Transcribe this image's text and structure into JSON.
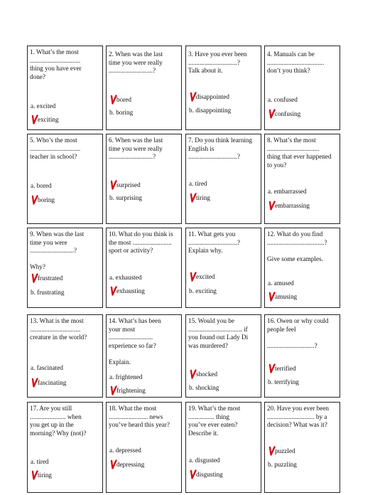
{
  "colors": {
    "tick": "#d0141b",
    "border": "#222222",
    "text": "#111111"
  },
  "cards": [
    {
      "id": 1,
      "lines": [
        "1. What’s the most",
        "...............................",
        "thing you have ever",
        "done?"
      ],
      "options": [
        {
          "label": "a. excited",
          "ticked": false
        },
        {
          "label": "exciting",
          "ticked": true
        }
      ]
    },
    {
      "id": 2,
      "lines": [
        "2. When was the last",
        "time you were really",
        "...........................?"
      ],
      "options": [
        {
          "label": "bored",
          "ticked": true
        },
        {
          "label": "b. boring",
          "ticked": false
        }
      ]
    },
    {
      "id": 3,
      "lines": [
        "3. Have you ever been",
        "..............................?",
        "Talk about it."
      ],
      "options": [
        {
          "label": "disappointed",
          "ticked": true
        },
        {
          "label": "b. disappointing",
          "ticked": false
        }
      ]
    },
    {
      "id": 4,
      "lines": [
        "4. Manuals can be",
        "...................................",
        "don’t you think?"
      ],
      "options": [
        {
          "label": "a. confused",
          "ticked": false
        },
        {
          "label": "confusing",
          "ticked": true
        }
      ]
    },
    {
      "id": 5,
      "lines": [
        "5. Who’s the most",
        "...............................",
        "teacher in school?"
      ],
      "options": [
        {
          "label": "a. bored",
          "ticked": false
        },
        {
          "label": "boring",
          "ticked": true
        }
      ]
    },
    {
      "id": 6,
      "lines": [
        "6. When was the last",
        "time you were really",
        "...........................?"
      ],
      "options": [
        {
          "label": "surprised",
          "ticked": true
        },
        {
          "label": "b. surprising",
          "ticked": false
        }
      ]
    },
    {
      "id": 7,
      "lines": [
        "7. Do you think learning",
        "English is",
        "..............................?"
      ],
      "options": [
        {
          "label": "a. tired",
          "ticked": false
        },
        {
          "label": "tiring",
          "ticked": true
        }
      ]
    },
    {
      "id": 8,
      "lines": [
        "8. What’s the most",
        "................................",
        "thing that ever happened",
        "to you?"
      ],
      "options": [
        {
          "label": "a. embarrassed",
          "ticked": false
        },
        {
          "label": "embarrassing",
          "ticked": true
        }
      ]
    },
    {
      "id": 9,
      "lines": [
        "9. When was the last",
        "time you were",
        "...........................?",
        "",
        "Why?"
      ],
      "options": [
        {
          "label": "frustrated",
          "ticked": true
        },
        {
          "label": "b. frustrating",
          "ticked": false
        }
      ]
    },
    {
      "id": 10,
      "lines": [
        "10. What do you think is",
        "the most ........................",
        "sport or activity?"
      ],
      "options": [
        {
          "label": "a. exhausted",
          "ticked": false
        },
        {
          "label": "exhausting",
          "ticked": true
        }
      ]
    },
    {
      "id": 11,
      "lines": [
        "11. What gets you",
        "..............................?",
        "Explain why."
      ],
      "options": [
        {
          "label": "excited",
          "ticked": true
        },
        {
          "label": "b. exciting",
          "ticked": false
        }
      ]
    },
    {
      "id": 12,
      "lines": [
        "12. What do you find",
        "...................................?",
        "",
        "Give some examples."
      ],
      "options": [
        {
          "label": "a. amused",
          "ticked": false
        },
        {
          "label": "amusing",
          "ticked": true
        }
      ]
    },
    {
      "id": 13,
      "lines": [
        "13. What is the most",
        "...............................",
        "creature in the world?"
      ],
      "options": [
        {
          "label": "a. fascinated",
          "ticked": false
        },
        {
          "label": "fascinating",
          "ticked": true
        }
      ]
    },
    {
      "id": 14,
      "lines": [
        "14. What’s has been",
        "your most",
        "...........................",
        "experience so far?",
        "",
        "Explain."
      ],
      "options": [
        {
          "label": "a. frightened",
          "ticked": false
        },
        {
          "label": "frightening",
          "ticked": true
        }
      ]
    },
    {
      "id": 15,
      "lines": [
        "15. Would you be",
        "................................. if",
        "you found out Lady Di",
        "was murdered?"
      ],
      "options": [
        {
          "label": "shocked",
          "ticked": true
        },
        {
          "label": "b. shocking",
          "ticked": false
        }
      ]
    },
    {
      "id": 16,
      "lines": [
        "16. Owen or why could",
        "people feel",
        "",
        ".............................?"
      ],
      "options": [
        {
          "label": "terrified",
          "ticked": true
        },
        {
          "label": "b. terrifying",
          "ticked": false
        }
      ]
    },
    {
      "id": 17,
      "lines": [
        "17. Are you still",
        "...................... when",
        "you get up in the",
        "morning? Why (not)?"
      ],
      "options": [
        {
          "label": "a. tired",
          "ticked": false
        },
        {
          "label": "tiring",
          "ticked": true
        }
      ]
    },
    {
      "id": 18,
      "lines": [
        "18. What the most",
        "........................ news",
        "you’ve heard this year?"
      ],
      "options": [
        {
          "label": "a. depressed",
          "ticked": false
        },
        {
          "label": "depressing",
          "ticked": true
        }
      ]
    },
    {
      "id": 19,
      "lines": [
        "19. What’s the most",
        "................ thing",
        "you’ve ever eaten?",
        "Describe it."
      ],
      "options": [
        {
          "label": "a. disgusted",
          "ticked": false
        },
        {
          "label": "disgusting",
          "ticked": true
        }
      ]
    },
    {
      "id": 20,
      "lines": [
        "20. Have you ever been",
        "............................. by a",
        "decision? What was it?"
      ],
      "options": [
        {
          "label": "puzzled",
          "ticked": true
        },
        {
          "label": "b. puzzling",
          "ticked": false
        }
      ]
    }
  ]
}
